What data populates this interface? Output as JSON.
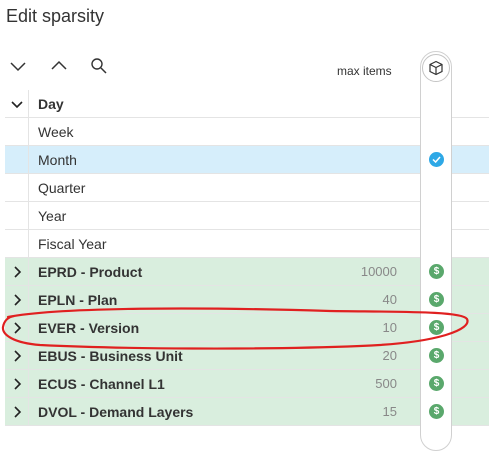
{
  "title": "Edit sparsity",
  "toolbar": {
    "collapse_icon": "chevron-down-icon",
    "expand_icon": "chevron-up-icon",
    "search_icon": "search-icon",
    "max_items_label": "max items",
    "column_icon": "cube-icon"
  },
  "rows": [
    {
      "label": "Day",
      "value": "",
      "bold": true,
      "chevron": "down",
      "badge": "",
      "style": "plain"
    },
    {
      "label": "Week",
      "value": "",
      "bold": false,
      "chevron": "",
      "badge": "",
      "style": "plain"
    },
    {
      "label": "Month",
      "value": "",
      "bold": false,
      "chevron": "",
      "badge": "check",
      "style": "selected"
    },
    {
      "label": "Quarter",
      "value": "",
      "bold": false,
      "chevron": "",
      "badge": "",
      "style": "plain"
    },
    {
      "label": "Year",
      "value": "",
      "bold": false,
      "chevron": "",
      "badge": "",
      "style": "plain"
    },
    {
      "label": "Fiscal Year",
      "value": "",
      "bold": false,
      "chevron": "",
      "badge": "",
      "style": "plain"
    },
    {
      "label": "EPRD - Product",
      "value": "10000",
      "bold": true,
      "chevron": "right",
      "badge": "dollar",
      "style": "dim"
    },
    {
      "label": "EPLN - Plan",
      "value": "40",
      "bold": true,
      "chevron": "right",
      "badge": "dollar",
      "style": "dim"
    },
    {
      "label": "EVER - Version",
      "value": "10",
      "bold": true,
      "chevron": "right",
      "badge": "dollar",
      "style": "dim"
    },
    {
      "label": "EBUS - Business Unit",
      "value": "20",
      "bold": true,
      "chevron": "right",
      "badge": "dollar",
      "style": "dim"
    },
    {
      "label": "ECUS - Channel L1",
      "value": "500",
      "bold": true,
      "chevron": "right",
      "badge": "dollar",
      "style": "dim"
    },
    {
      "label": "DVOL - Demand Layers",
      "value": "15",
      "bold": true,
      "chevron": "right",
      "badge": "dollar",
      "style": "dim"
    }
  ],
  "badge_dollar_glyph": "$",
  "colors": {
    "selected_row": "#d6eefb",
    "dim_row": "#d9eede",
    "check_badge": "#2ea8e6",
    "dollar_badge": "#5aa86c",
    "annotation": "#e02020"
  }
}
